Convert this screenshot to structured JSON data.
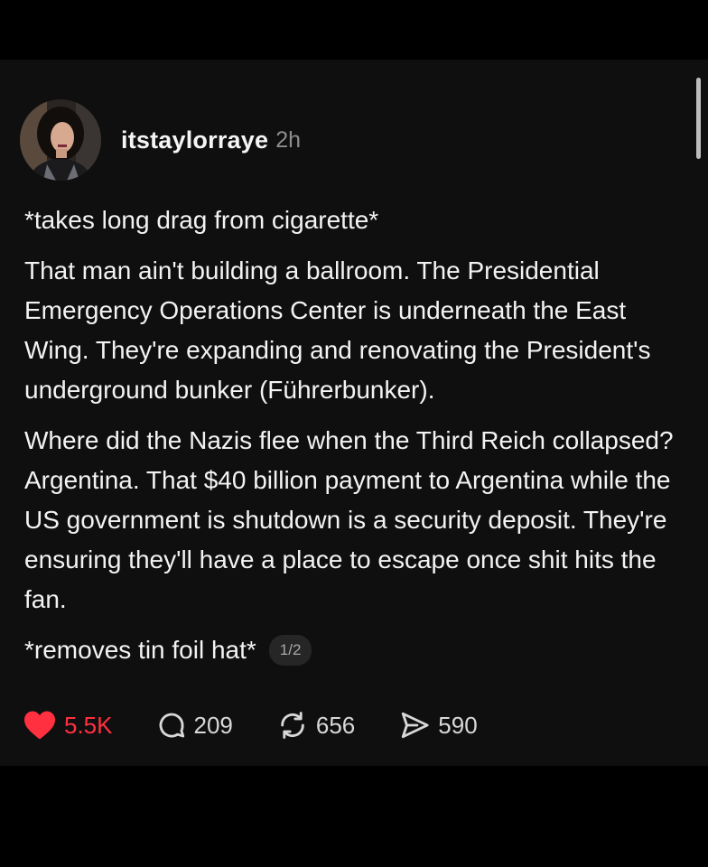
{
  "post": {
    "username": "itstaylorraye",
    "time": "2h",
    "paragraphs": [
      "*takes long drag from cigarette*",
      "That man ain't building a ballroom. The Presidential Emergency Operations Center is underneath the East Wing. They're expanding and renovating the President's underground bunker (Führerbunker).",
      "Where did the Nazis flee when the Third Reich collapsed? Argentina. That $40 billion payment to Argentina while the US government is shutdown is a security deposit. They're ensuring they'll have a place to escape once shit hits the fan."
    ],
    "last_line": "*removes tin foil hat*",
    "page_indicator": "1/2"
  },
  "actions": {
    "likes": "5.5K",
    "replies": "209",
    "reposts": "656",
    "shares": "590"
  },
  "colors": {
    "like": "#ff3040",
    "background": "#0f0f0f"
  },
  "icons": [
    "heart-icon",
    "comment-icon",
    "repost-icon",
    "share-icon"
  ]
}
